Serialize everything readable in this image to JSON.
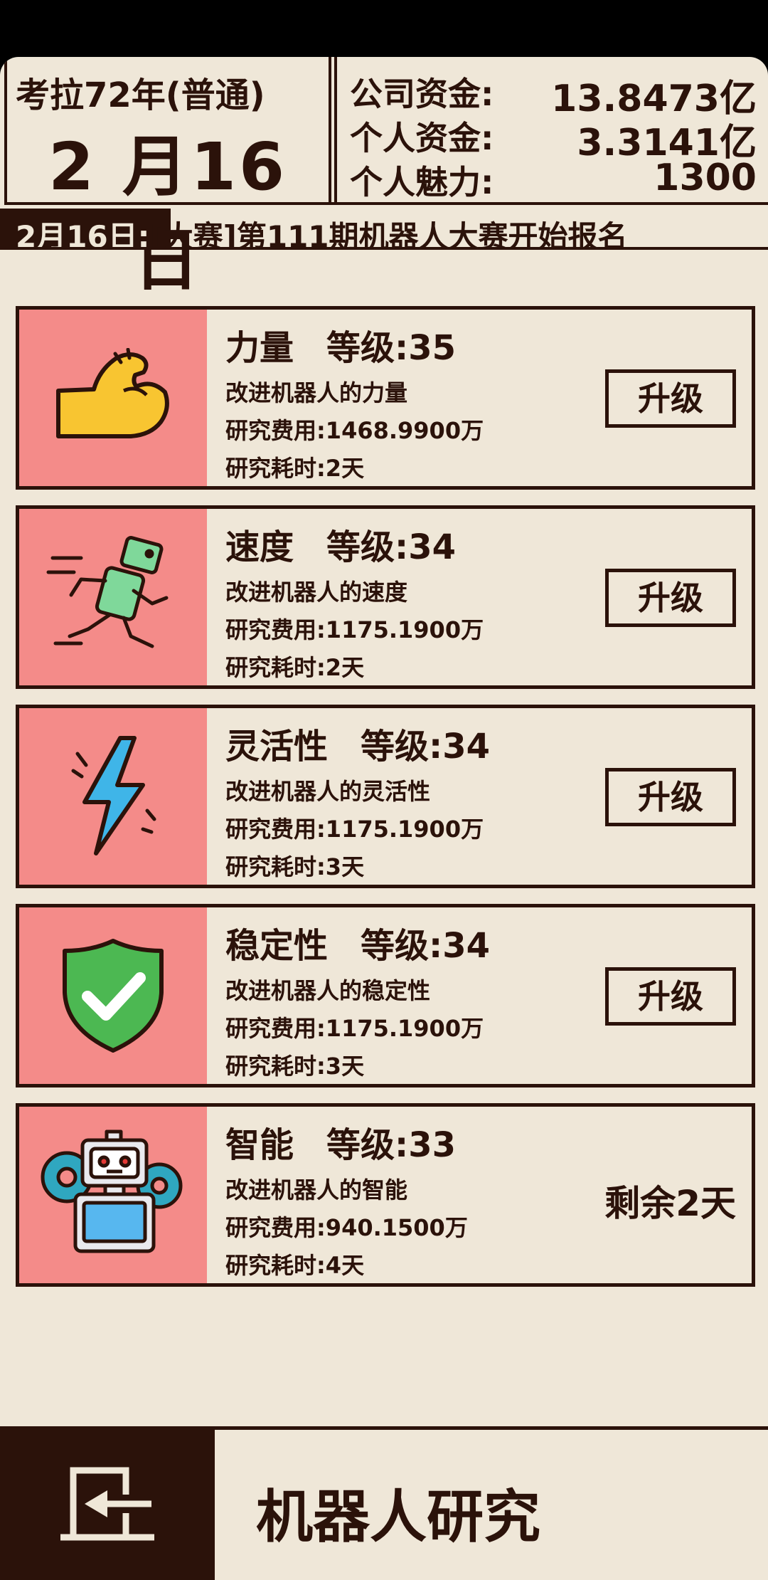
{
  "header": {
    "year_mode": "考拉72年(普通)",
    "date": "2 月16 日",
    "stats": [
      {
        "label": "公司资金:",
        "value": "13.8473亿"
      },
      {
        "label": "个人资金:",
        "value": "3.3141亿"
      },
      {
        "label": "个人魅力:",
        "value": "1300"
      }
    ]
  },
  "ticker": {
    "date_prefix": "2月16日:",
    "message": "[大赛]第111期机器人大赛开始报名"
  },
  "research_items": [
    {
      "name": "力量",
      "level": "等级:35",
      "desc": "改进机器人的力量",
      "cost": "研究费用:1468.9900万",
      "time": "研究耗时:2天",
      "action": "升级",
      "icon": "flexed-arm-icon"
    },
    {
      "name": "速度",
      "level": "等级:34",
      "desc": "改进机器人的速度",
      "cost": "研究费用:1175.1900万",
      "time": "研究耗时:2天",
      "action": "升级",
      "icon": "running-robot-icon"
    },
    {
      "name": "灵活性",
      "level": "等级:34",
      "desc": "改进机器人的灵活性",
      "cost": "研究费用:1175.1900万",
      "time": "研究耗时:3天",
      "action": "升级",
      "icon": "lightning-bolt-icon"
    },
    {
      "name": "稳定性",
      "level": "等级:34",
      "desc": "改进机器人的稳定性",
      "cost": "研究费用:1175.1900万",
      "time": "研究耗时:3天",
      "action": "升级",
      "icon": "shield-check-icon"
    },
    {
      "name": "智能",
      "level": "等级:33",
      "desc": "改进机器人的智能",
      "cost": "研究费用:940.1500万",
      "time": "研究耗时:4天",
      "remaining": "剩余2天",
      "icon": "robot-gear-icon"
    }
  ],
  "footer": {
    "title": "机器人研究",
    "exit_icon": "exit-door-icon"
  },
  "colors": {
    "background": "#efe7d8",
    "dark": "#2b120a",
    "card_icon_bg": "#f48b89"
  }
}
